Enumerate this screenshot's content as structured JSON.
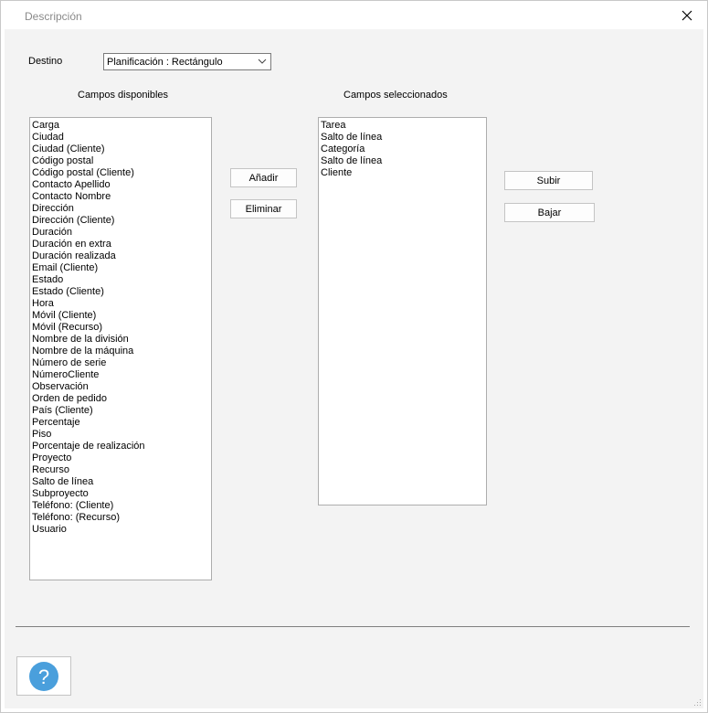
{
  "window": {
    "title": "Descripción",
    "close_icon": "close-icon"
  },
  "destination": {
    "label": "Destino",
    "selected": "Planificación : Rectángulo"
  },
  "available": {
    "header": "Campos disponibles",
    "items": [
      "Carga",
      "Ciudad",
      "Ciudad  (Cliente)",
      "Código postal",
      "Código postal  (Cliente)",
      "Contacto Apellido",
      "Contacto Nombre",
      "Dirección",
      "Dirección (Cliente)",
      "Duración",
      "Duración en extra",
      "Duración realizada",
      "Email (Cliente)",
      "Estado",
      "Estado (Cliente)",
      "Hora",
      "Móvil (Cliente)",
      "Móvil (Recurso)",
      "Nombre de la división",
      "Nombre de la máquina",
      "Número de serie",
      "NúmeroCliente",
      "Observación",
      "Orden de pedido",
      "País (Cliente)",
      "Percentaje",
      "Piso",
      "Porcentaje de realización",
      "Proyecto",
      "Recurso",
      "Salto de línea",
      "Subproyecto",
      "Teléfono: (Cliente)",
      "Teléfono: (Recurso)",
      "Usuario"
    ]
  },
  "selected": {
    "header": "Campos seleccionados",
    "items": [
      "Tarea",
      "Salto de línea",
      "Categoría",
      "Salto de línea",
      "Cliente"
    ]
  },
  "buttons": {
    "add": "Añadir",
    "remove": "Eliminar",
    "up": "Subir",
    "down": "Bajar",
    "help_icon": "help-icon"
  },
  "colors": {
    "help_blue": "#4a9fdc"
  }
}
